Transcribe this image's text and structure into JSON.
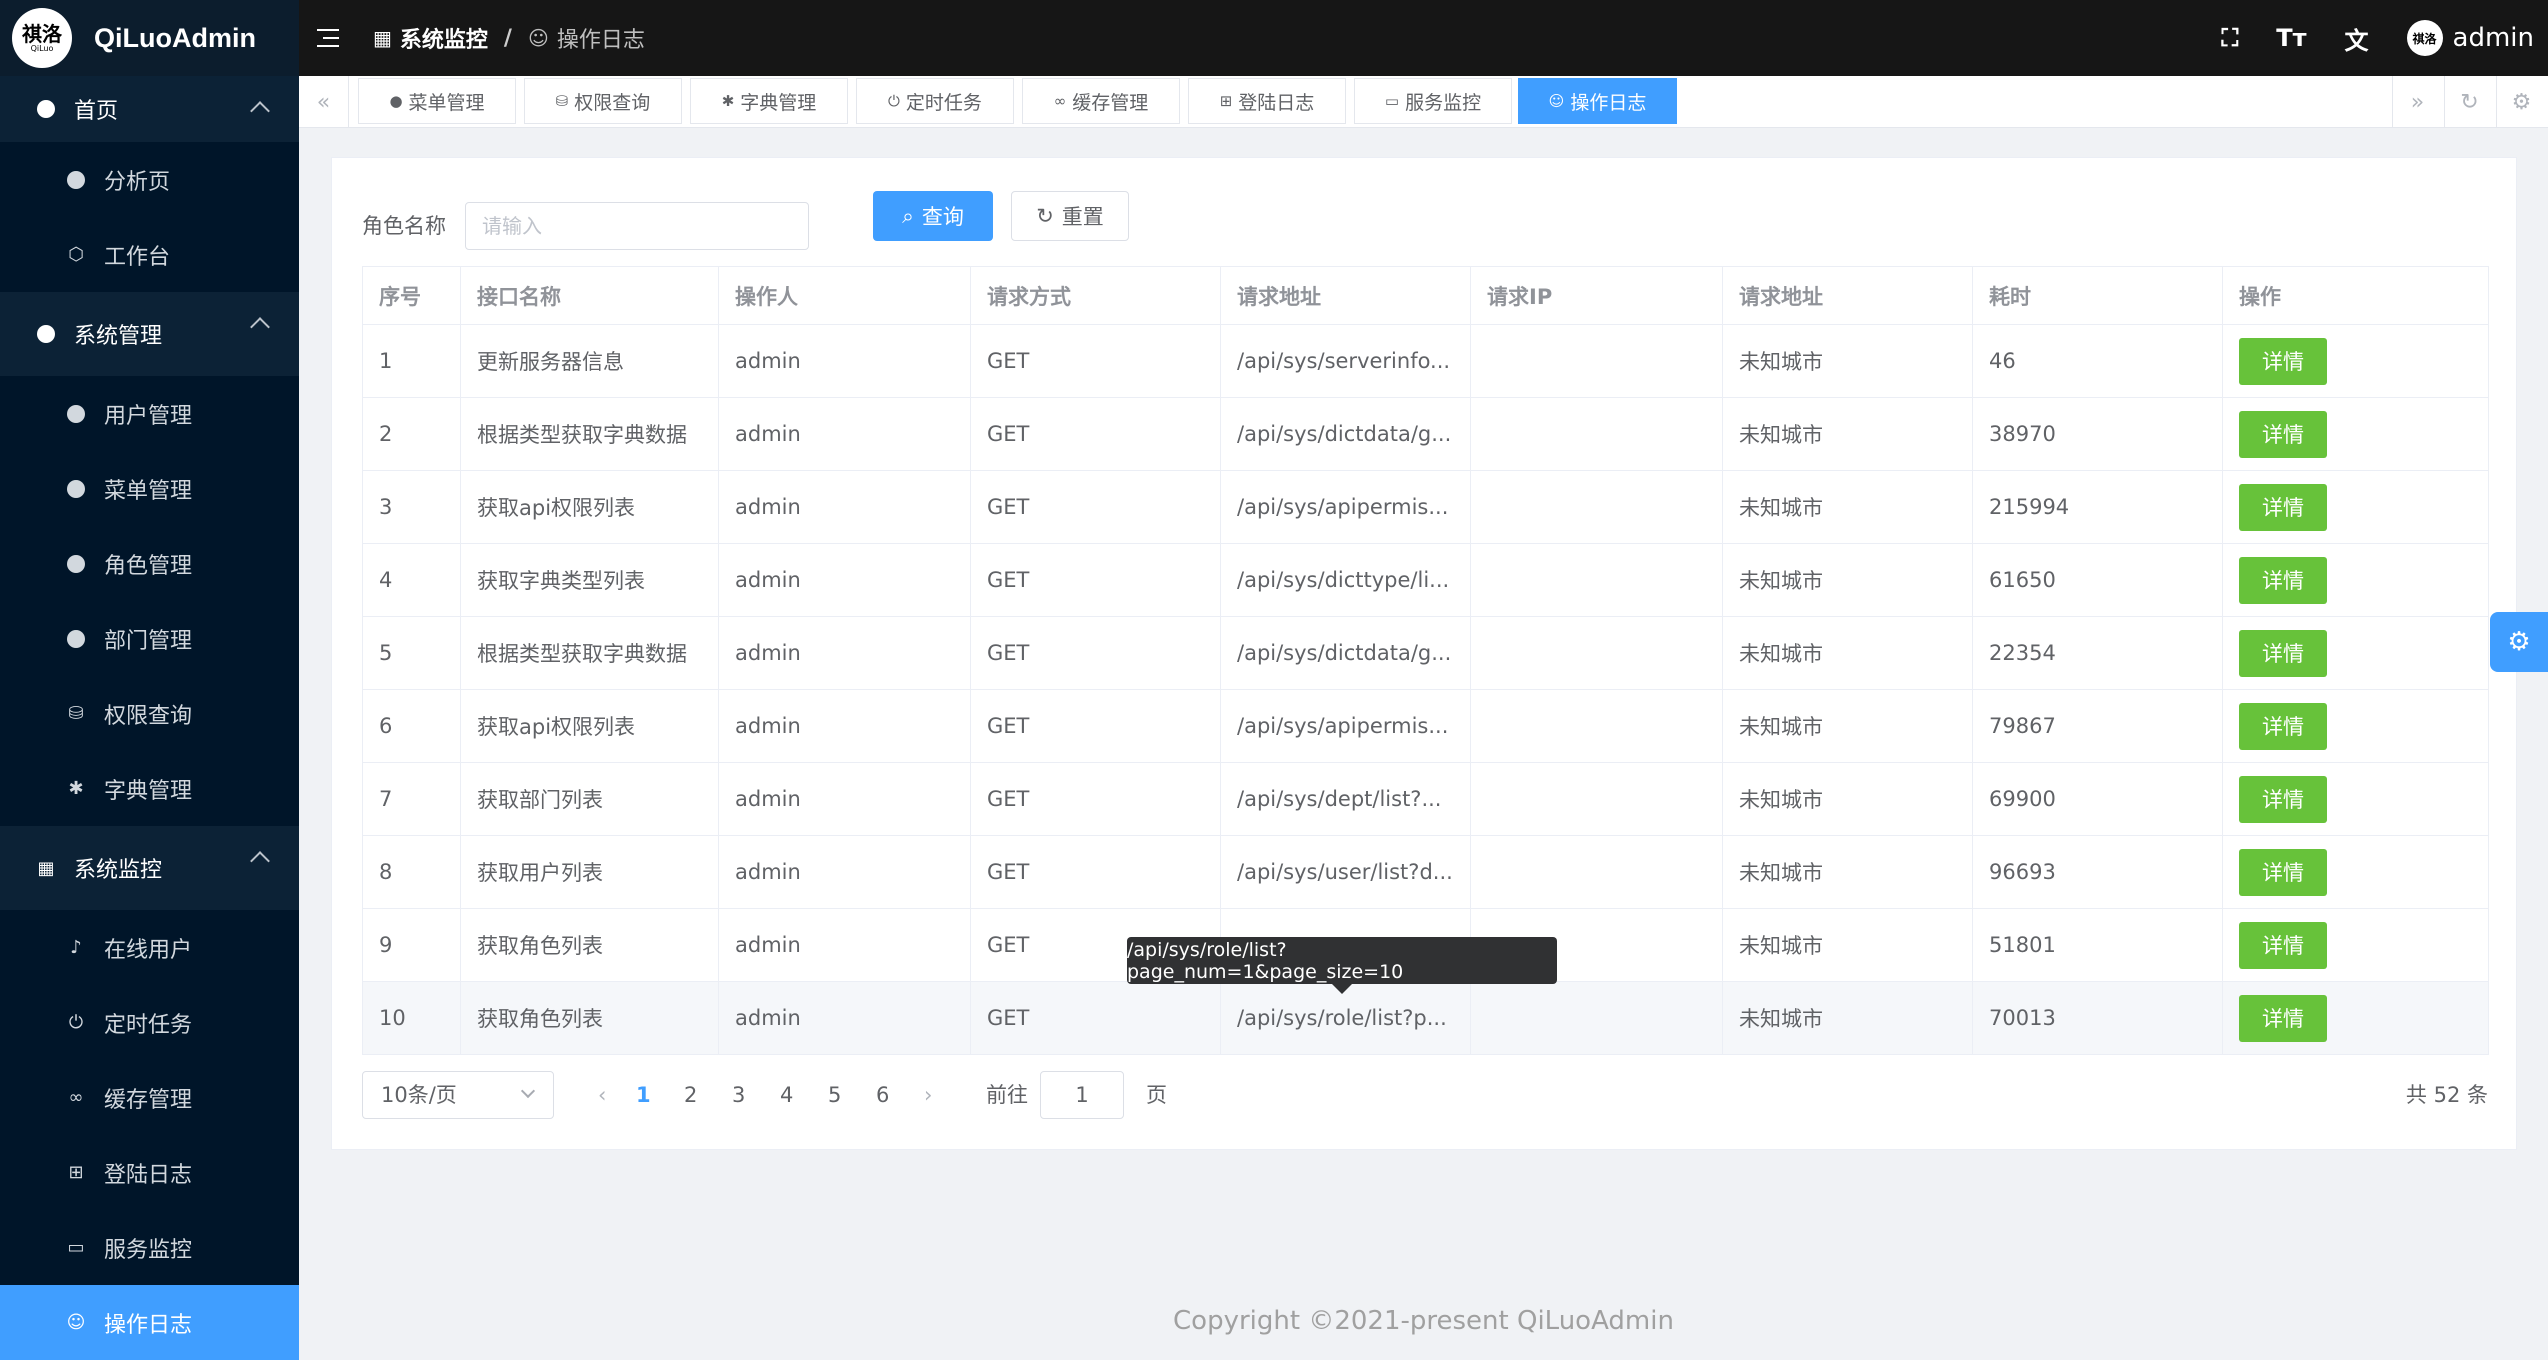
{
  "app": {
    "logo_text": "祺洛",
    "logo_sub": "QiLuo",
    "title": "QiLuoAdmin"
  },
  "colors": {
    "primary": "#409eff",
    "success": "#67c23a",
    "sidebar": "#001529",
    "header": "#161616"
  },
  "sidebar": {
    "groups": [
      {
        "label": "首页",
        "icon": "dashboard-icon",
        "items": [
          {
            "label": "分析页"
          },
          {
            "label": "工作台"
          }
        ]
      },
      {
        "label": "系统管理",
        "icon": "dashboard-icon",
        "items": [
          {
            "label": "用户管理"
          },
          {
            "label": "菜单管理"
          },
          {
            "label": "角色管理"
          },
          {
            "label": "部门管理"
          },
          {
            "label": "权限查询"
          },
          {
            "label": "字典管理"
          }
        ]
      },
      {
        "label": "系统监控",
        "icon": "monitor-icon",
        "items": [
          {
            "label": "在线用户"
          },
          {
            "label": "定时任务"
          },
          {
            "label": "缓存管理"
          },
          {
            "label": "登陆日志"
          },
          {
            "label": "服务监控"
          },
          {
            "label": "操作日志"
          }
        ]
      }
    ]
  },
  "header": {
    "breadcrumb": [
      "系统监控",
      "操作日志"
    ],
    "user": "admin",
    "avatar_text": "祺洛"
  },
  "tabs": [
    "菜单管理",
    "权限查询",
    "字典管理",
    "定时任务",
    "缓存管理",
    "登陆日志",
    "服务监控",
    "操作日志"
  ],
  "search": {
    "label": "角色名称",
    "placeholder": "请输入",
    "query_label": "查询",
    "reset_label": "重置"
  },
  "table": {
    "headers": [
      "序号",
      "接口名称",
      "操作人",
      "请求方式",
      "请求地址",
      "请求IP",
      "请求地址",
      "耗时",
      "操作"
    ],
    "rows": [
      [
        "1",
        "更新服务器信息",
        "admin",
        "GET",
        "/api/sys/serverinfo...",
        "",
        "未知城市",
        "46",
        "详情"
      ],
      [
        "2",
        "根据类型获取字典数据",
        "admin",
        "GET",
        "/api/sys/dictdata/g...",
        "",
        "未知城市",
        "38970",
        "详情"
      ],
      [
        "3",
        "获取api权限列表",
        "admin",
        "GET",
        "/api/sys/apipermis...",
        "",
        "未知城市",
        "215994",
        "详情"
      ],
      [
        "4",
        "获取字典类型列表",
        "admin",
        "GET",
        "/api/sys/dicttype/li...",
        "",
        "未知城市",
        "61650",
        "详情"
      ],
      [
        "5",
        "根据类型获取字典数据",
        "admin",
        "GET",
        "/api/sys/dictdata/g...",
        "",
        "未知城市",
        "22354",
        "详情"
      ],
      [
        "6",
        "获取api权限列表",
        "admin",
        "GET",
        "/api/sys/apipermis...",
        "",
        "未知城市",
        "79867",
        "详情"
      ],
      [
        "7",
        "获取部门列表",
        "admin",
        "GET",
        "/api/sys/dept/list?...",
        "",
        "未知城市",
        "69900",
        "详情"
      ],
      [
        "8",
        "获取用户列表",
        "admin",
        "GET",
        "/api/sys/user/list?d...",
        "",
        "未知城市",
        "96693",
        "详情"
      ],
      [
        "9",
        "获取角色列表",
        "admin",
        "GET",
        "",
        "",
        "未知城市",
        "51801",
        "详情"
      ],
      [
        "10",
        "获取角色列表",
        "admin",
        "GET",
        "/api/sys/role/list?p...",
        "",
        "未知城市",
        "70013",
        "详情"
      ]
    ]
  },
  "tooltip": "/api/sys/role/list?page_num=1&page_size=10",
  "pagination": {
    "page_size": "10条/页",
    "pages": [
      "1",
      "2",
      "3",
      "4",
      "5",
      "6"
    ],
    "current": "1",
    "goto_label": "前往",
    "goto_value": "1",
    "page_suffix": "页",
    "total": "共 52 条"
  },
  "footer": {
    "copyright": "Copyright ©2021-present QiLuoAdmin"
  }
}
